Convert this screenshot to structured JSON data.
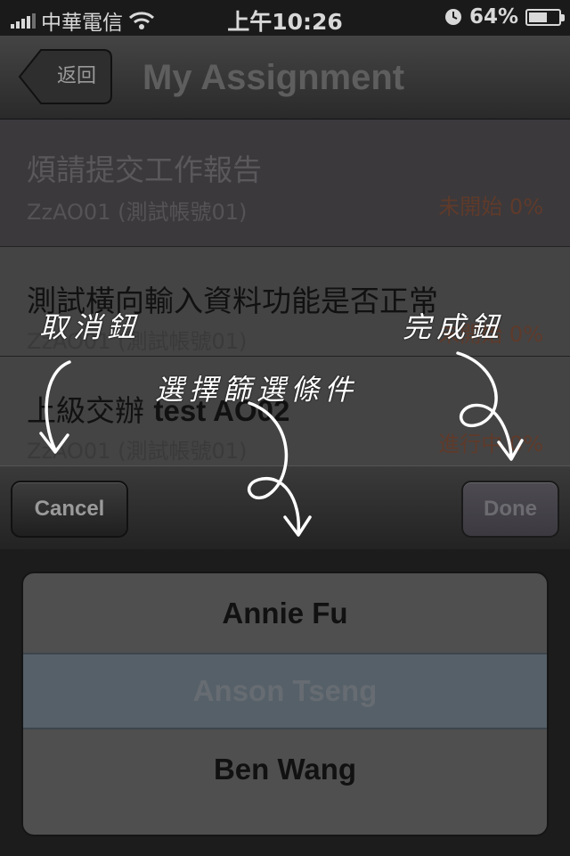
{
  "status_bar": {
    "carrier": "中華電信",
    "time": "上午10:26",
    "battery": "64%",
    "battery_level": 0.64
  },
  "nav": {
    "back_label": "返回",
    "title": "My Assignment"
  },
  "list": [
    {
      "title": "煩請提交工作報告",
      "sub": "ZzAO01 (測試帳號01)",
      "status": "未開始 0%"
    },
    {
      "title": "測試橫向輸入資料功能是否正常",
      "sub": "ZzAO01 (測試帳號01)",
      "status": "未開始 0%"
    },
    {
      "title_prefix": "上級交辦 ",
      "title_bold": "test AO02",
      "sub": "ZzAO01 (測試帳號01)",
      "status": "進行中 0%"
    }
  ],
  "toolbar": {
    "cancel_label": "Cancel",
    "done_label": "Done"
  },
  "picker": {
    "options": [
      "Annie Fu",
      "Anson Tseng",
      "Ben Wang"
    ],
    "selected": "Anson Tseng"
  },
  "annotations": {
    "cancel": "取消鈕",
    "done": "完成鈕",
    "filter": "選擇篩選條件"
  },
  "icons": {
    "wifi": "wifi-icon",
    "clock": "clock-icon",
    "battery": "battery-icon",
    "signal": "signal-icon"
  }
}
